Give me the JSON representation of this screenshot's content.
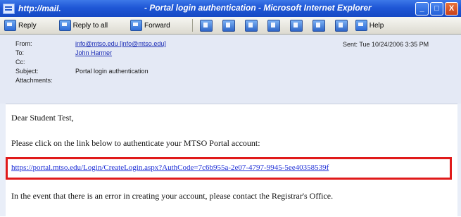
{
  "window": {
    "url": "http://mail.",
    "title": "- Portal login authentication - Microsoft Internet Explorer",
    "controls": {
      "minimize": "_",
      "maximize": "□",
      "close": "X"
    }
  },
  "toolbar": {
    "reply": "Reply",
    "reply_all": "Reply to all",
    "forward": "Forward",
    "help": "Help"
  },
  "headers": {
    "from_label": "From:",
    "from_value": "info@mtso.edu [info@mtso.edu]",
    "to_label": "To:",
    "to_value": "John Harmer",
    "cc_label": "Cc:",
    "cc_value": "",
    "subject_label": "Subject:",
    "subject_value": "Portal login authentication",
    "attachments_label": "Attachments:",
    "sent": "Sent: Tue 10/24/2006 3:35 PM"
  },
  "message": {
    "greeting": "Dear Student Test,",
    "instruction": "Please click on the link below to authenticate your MTSO Portal account:",
    "link": "https://portal.mtso.edu/Login/CreateLogin.aspx?AuthCode=7c6b955a-2e07-4797-9945-5ee40358539f",
    "error_note": "In the event that there is an error in creating your account, please contact the Registrar's Office."
  },
  "colors": {
    "titlebar": "#1f57d6",
    "highlight_box": "#e01a1a",
    "link": "#1a2bd6"
  }
}
